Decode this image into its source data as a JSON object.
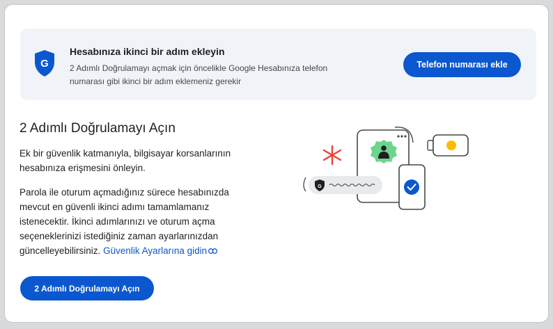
{
  "banner": {
    "title": "Hesabınıza ikinci bir adım ekleyin",
    "description": "2 Adımlı Doğrulamayı açmak için öncelikle Google Hesabınıza telefon numarası gibi ikinci bir adım eklemeniz gerekir",
    "button_label": "Telefon numarası ekle",
    "shield_icon": "google-shield-icon"
  },
  "main": {
    "heading": "2 Adımlı Doğrulamayı Açın",
    "paragraph1": "Ek bir güvenlik katmanıyla, bilgisayar korsanlarının hesabınıza erişmesini önleyin.",
    "paragraph2": "Parola ile oturum açmadığınız sürece hesabınızda mevcut en güvenli ikinci adımı tamamlamanız istenecektir. İkinci adımlarınızı ve oturum açma seçeneklerinizi istediğiniz zaman ayarlarınızdan güncelleyebilirsiniz.",
    "link_label": "Güvenlik Ayarlarına gidin",
    "button_label": "2 Adımlı Doğrulamayı Açın"
  },
  "colors": {
    "primary": "#0b57d0",
    "banner_bg": "#f0f4f9",
    "green_badge": "#6dd58c",
    "red_asterisk": "#e94235",
    "yellow_dot": "#fbbc04"
  }
}
